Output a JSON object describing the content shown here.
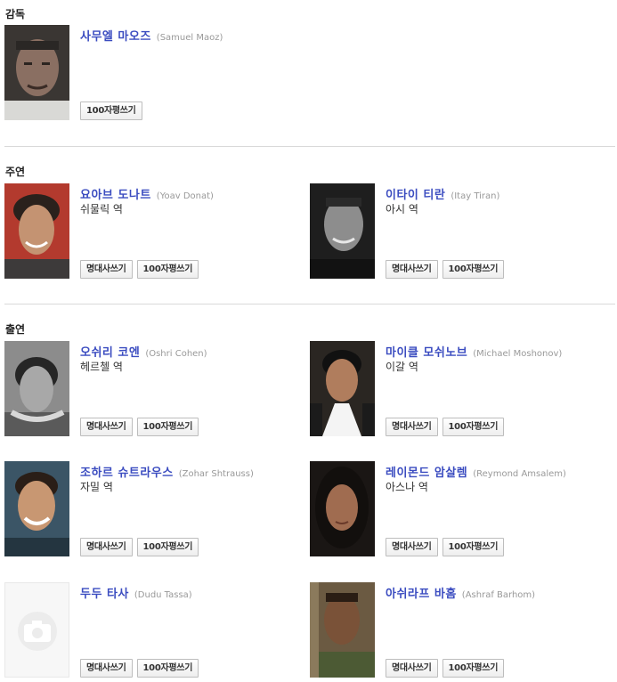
{
  "sections": {
    "director": "감독",
    "lead": "주연",
    "support": "출연"
  },
  "buttons": {
    "quote": "명대사쓰기",
    "review": "100자평쓰기"
  },
  "people": {
    "director": {
      "name_ko": "사무엘 마오즈",
      "name_en": "(Samuel Maoz)",
      "role": ""
    },
    "p1": {
      "name_ko": "요아브 도나트",
      "name_en": "(Yoav Donat)",
      "role": "쉬물릭 역"
    },
    "p2": {
      "name_ko": "이타이 티란",
      "name_en": "(Itay Tiran)",
      "role": "아시 역"
    },
    "p3": {
      "name_ko": "오쉬리 코엔",
      "name_en": "(Oshri Cohen)",
      "role": "헤르첼 역"
    },
    "p4": {
      "name_ko": "마이클 모쉬노브",
      "name_en": "(Michael Moshonov)",
      "role": "이갈 역"
    },
    "p5": {
      "name_ko": "조하르 슈트라우스",
      "name_en": "(Zohar Shtrauss)",
      "role": "자밀 역"
    },
    "p6": {
      "name_ko": "레이몬드 암살렘",
      "name_en": "(Reymond Amsalem)",
      "role": "아스나 역"
    },
    "p7": {
      "name_ko": "두두 타사",
      "name_en": "(Dudu Tassa)",
      "role": ""
    },
    "p8": {
      "name_ko": "아쉬라프 바홈",
      "name_en": "(Ashraf Barhom)",
      "role": ""
    }
  }
}
